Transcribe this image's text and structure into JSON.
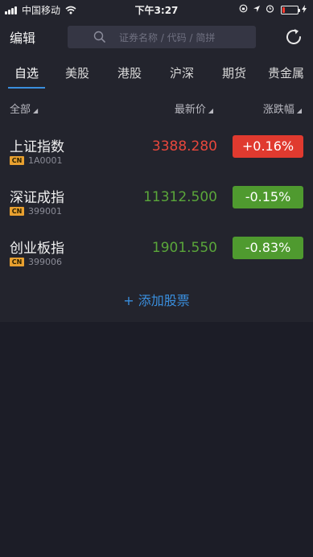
{
  "status_bar": {
    "carrier": "中国移动",
    "time": "下午3:27"
  },
  "header": {
    "edit_label": "编辑",
    "search_placeholder": "证券名称 / 代码 / 简拼"
  },
  "tabs": [
    {
      "label": "自选",
      "active": true
    },
    {
      "label": "美股",
      "active": false
    },
    {
      "label": "港股",
      "active": false
    },
    {
      "label": "沪深",
      "active": false
    },
    {
      "label": "期货",
      "active": false
    },
    {
      "label": "贵金属",
      "active": false
    }
  ],
  "list_header": {
    "all": "全部",
    "price": "最新价",
    "change": "涨跌幅"
  },
  "rows": [
    {
      "name": "上证指数",
      "badge": "CN",
      "code": "1A0001",
      "price": "3388.280",
      "change": "+0.16%",
      "direction": "up"
    },
    {
      "name": "深证成指",
      "badge": "CN",
      "code": "399001",
      "price": "11312.500",
      "change": "-0.15%",
      "direction": "down"
    },
    {
      "name": "创业板指",
      "badge": "CN",
      "code": "399006",
      "price": "1901.550",
      "change": "-0.83%",
      "direction": "down"
    }
  ],
  "add_stock_label": "+ 添加股票",
  "colors": {
    "up": "#e03a2f",
    "up_text": "#e8473c",
    "down": "#4f9a2f",
    "down_text": "#5aa63a",
    "accent": "#3a8fde",
    "background": "#1c1d27",
    "panel": "#23242d"
  },
  "icons": {
    "search": "search-icon",
    "refresh": "refresh-icon",
    "wifi": "wifi-icon",
    "battery": "battery-icon"
  }
}
